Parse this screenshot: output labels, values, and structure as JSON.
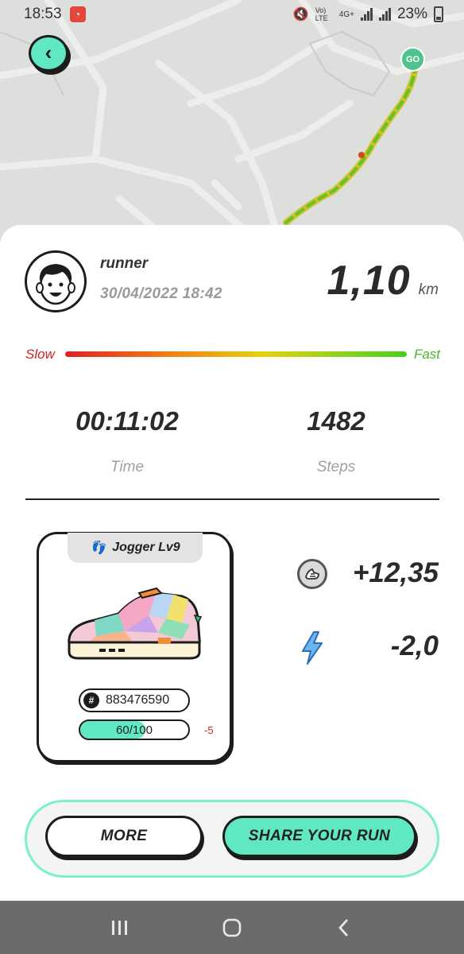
{
  "status_bar": {
    "time": "18:53",
    "network": "4G+",
    "battery": "23%",
    "volte": "Vo) LTE"
  },
  "map": {
    "start_marker": "GO"
  },
  "run": {
    "username": "runner",
    "datetime": "30/04/2022 18:42",
    "distance": "1,10",
    "distance_unit": "km",
    "speed_slow_label": "Slow",
    "speed_fast_label": "Fast",
    "time_value": "00:11:02",
    "time_label": "Time",
    "steps_value": "1482",
    "steps_label": "Steps"
  },
  "sneaker": {
    "level": "Jogger Lv9",
    "id": "883476590",
    "durability_text": "60/100",
    "durability_fraction": 0.6,
    "durability_delta": "-5"
  },
  "rewards": {
    "coin_value": "+12,35",
    "energy_value": "-2,0"
  },
  "buttons": {
    "more": "MORE",
    "share": "SHARE YOUR RUN"
  },
  "colors": {
    "accent": "#5fe8c2",
    "slow": "#d0241f",
    "fast": "#46b82a"
  },
  "icons": {
    "back": "back-arrow-icon",
    "coin": "coin-icon",
    "energy": "energy-bolt-icon",
    "footprints": "footprints-icon"
  }
}
